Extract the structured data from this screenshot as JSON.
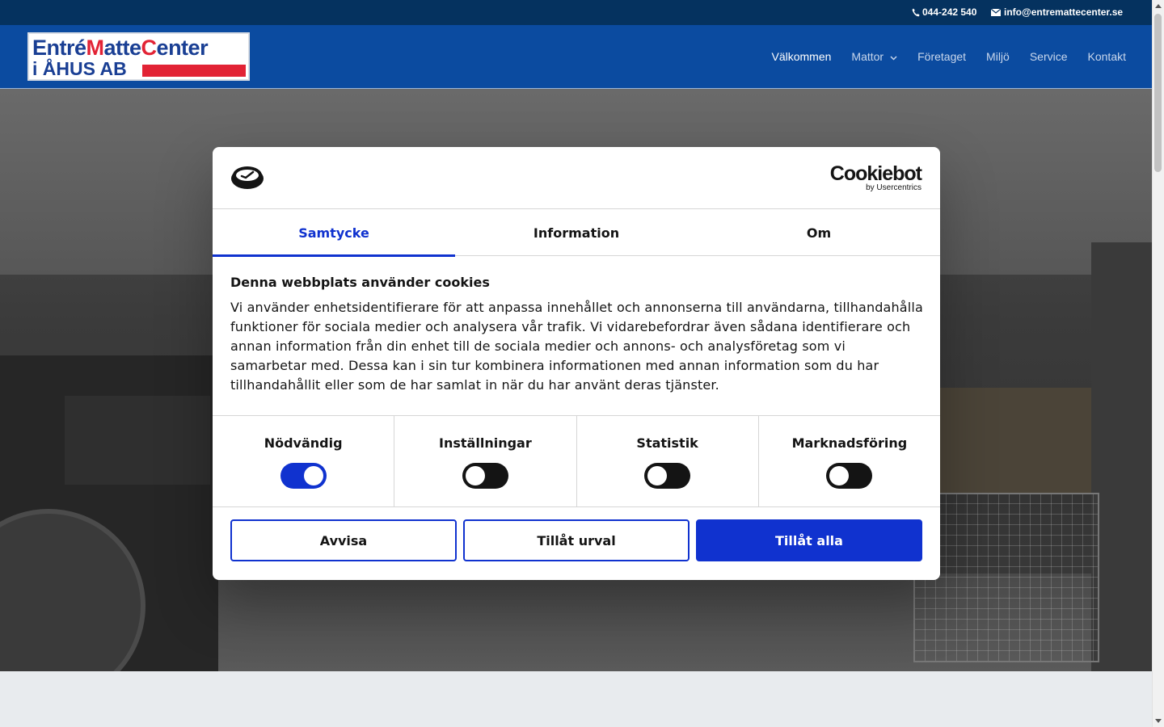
{
  "topbar": {
    "phone": "044-242 540",
    "email": "info@entremattecenter.se"
  },
  "logo": {
    "line1_part1": "Entré",
    "line1_part2": "M",
    "line1_part3": "atte",
    "line1_part4": "C",
    "line1_part5": "enter",
    "line2": "i ÅHUS AB"
  },
  "nav": {
    "items": [
      {
        "label": "Välkommen"
      },
      {
        "label": "Mattor"
      },
      {
        "label": "Företaget"
      },
      {
        "label": "Miljö"
      },
      {
        "label": "Service"
      },
      {
        "label": "Kontakt"
      }
    ]
  },
  "dialog": {
    "brand_main": "Cookiebot",
    "brand_sub": "by Usercentrics",
    "tabs": [
      {
        "label": "Samtycke"
      },
      {
        "label": "Information"
      },
      {
        "label": "Om"
      }
    ],
    "heading": "Denna webbplats använder cookies",
    "text": "Vi använder enhetsidentifierare för att anpassa innehållet och annonserna till användarna, tillhandahålla funktioner för sociala medier och analysera vår trafik. Vi vidarebefordrar även sådana identifierare och annan information från din enhet till de sociala medier och annons- och analysföretag som vi samarbetar med. Dessa kan i sin tur kombinera informationen med annan information som du har tillhandahållit eller som de har samlat in när du har använt deras tjänster.",
    "toggles": [
      {
        "label": "Nödvändig",
        "on": true
      },
      {
        "label": "Inställningar",
        "on": false
      },
      {
        "label": "Statistik",
        "on": false
      },
      {
        "label": "Marknadsföring",
        "on": false
      }
    ],
    "buttons": {
      "reject": "Avvisa",
      "allow_selection": "Tillåt urval",
      "allow_all": "Tillåt alla"
    }
  },
  "colors": {
    "accent": "#1032cf",
    "header_bg": "#0b4ba0",
    "topbar_bg": "#05325f",
    "logo_red": "#e22335"
  }
}
